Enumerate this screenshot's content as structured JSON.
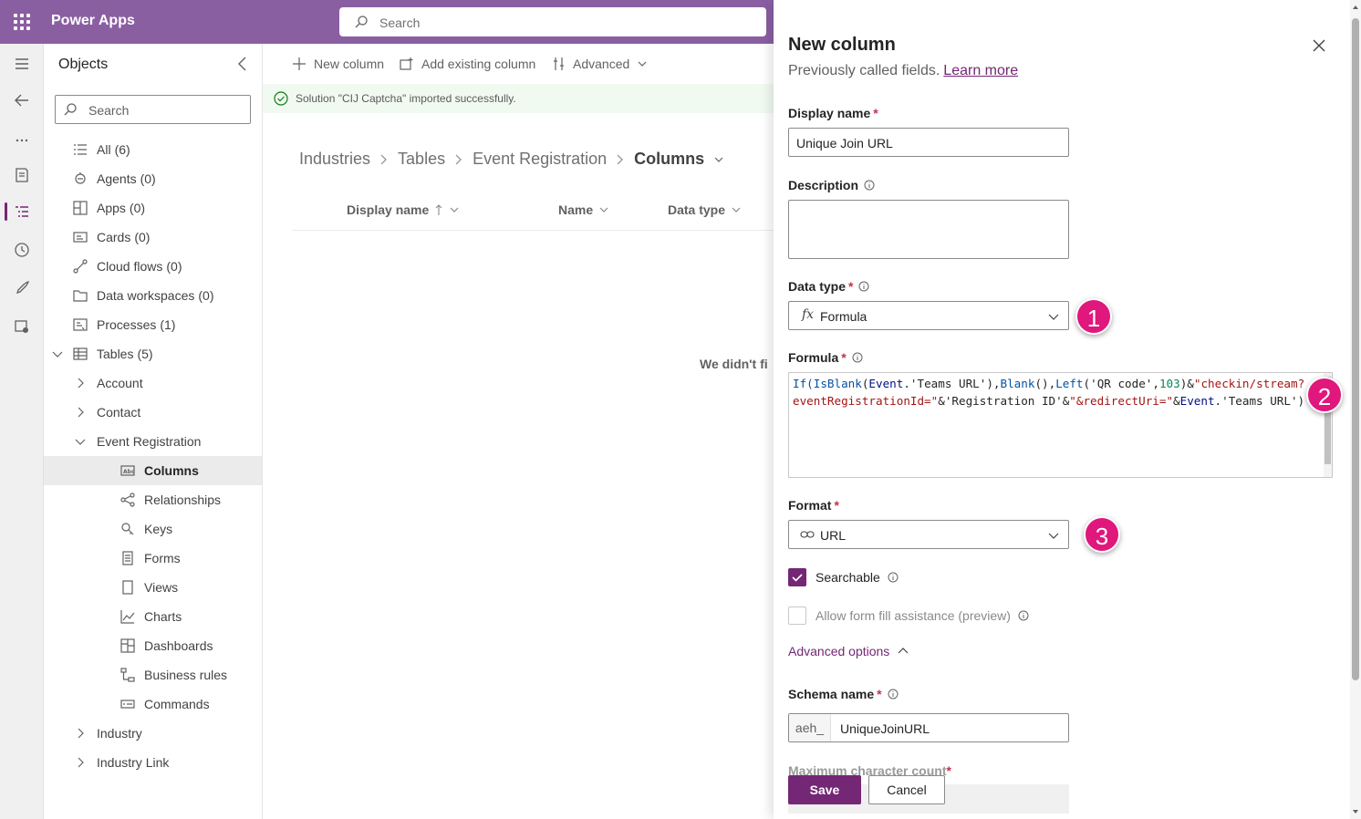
{
  "app": {
    "title": "Power Apps"
  },
  "topbar": {
    "search_placeholder": "Search"
  },
  "objects": {
    "title": "Objects",
    "search_placeholder": "Search",
    "items": [
      {
        "label": "All",
        "count": "(6)",
        "icon": "list-icon"
      },
      {
        "label": "Agents",
        "count": "(0)",
        "icon": "agent-icon"
      },
      {
        "label": "Apps",
        "count": "(0)",
        "icon": "apps-icon"
      },
      {
        "label": "Cards",
        "count": "(0)",
        "icon": "cards-icon"
      },
      {
        "label": "Cloud flows",
        "count": "(0)",
        "icon": "flow-icon"
      },
      {
        "label": "Data workspaces",
        "count": "(0)",
        "icon": "folder-icon"
      },
      {
        "label": "Processes",
        "count": "(1)",
        "icon": "process-icon"
      },
      {
        "label": "Tables",
        "count": "(5)",
        "icon": "table-icon"
      },
      {
        "label": "Account"
      },
      {
        "label": "Contact"
      },
      {
        "label": "Event Registration"
      },
      {
        "label": "Columns",
        "icon": "columns-icon"
      },
      {
        "label": "Relationships",
        "icon": "relationships-icon"
      },
      {
        "label": "Keys",
        "icon": "keys-icon"
      },
      {
        "label": "Forms",
        "icon": "forms-icon"
      },
      {
        "label": "Views",
        "icon": "views-icon"
      },
      {
        "label": "Charts",
        "icon": "charts-icon"
      },
      {
        "label": "Dashboards",
        "icon": "dashboards-icon"
      },
      {
        "label": "Business rules",
        "icon": "business-rules-icon"
      },
      {
        "label": "Commands",
        "icon": "commands-icon"
      },
      {
        "label": "Industry"
      },
      {
        "label": "Industry Link"
      }
    ]
  },
  "commandbar": {
    "new_column": "New column",
    "add_existing": "Add existing column",
    "advanced": "Advanced"
  },
  "notice": {
    "text": "Solution \"CIJ Captcha\" imported successfully."
  },
  "breadcrumb": {
    "items": [
      "Industries",
      "Tables",
      "Event Registration",
      "Columns"
    ]
  },
  "grid": {
    "headers": [
      "Display name",
      "Name",
      "Data type"
    ],
    "empty_message": "We didn't fi"
  },
  "panel": {
    "title": "New column",
    "subtitle": "Previously called fields.",
    "learn_more": "Learn more",
    "display_name_label": "Display name",
    "display_name_value": "Unique Join URL",
    "description_label": "Description",
    "data_type_label": "Data type",
    "data_type_value": "Formula",
    "formula_label": "Formula",
    "formula_line1": {
      "p1": "If(",
      "p2": "IsBlank",
      "p3": "(",
      "p4": "Event",
      "p5": ".'Teams URL'",
      "p6": "),",
      "p7": "Blank",
      "p8": "(),",
      "p9": "Left",
      "p10": "('QR code',",
      "p11": "103",
      "p12": ")&",
      "p13": "\"checkin/stream?"
    },
    "formula_line2": {
      "p1": "eventRegistrationId=\"",
      "p2": "&'Registration ID'&",
      "p3": "\"&redirectUri=\"",
      "p4": "&",
      "p5": "Event",
      "p6": ".'Teams URL')"
    },
    "format_label": "Format",
    "format_value": "URL",
    "searchable_label": "Searchable",
    "searchable_checked": true,
    "form_fill_label": "Allow form fill assistance (preview)",
    "form_fill_checked": false,
    "advanced_options": "Advanced options",
    "schema_label": "Schema name",
    "schema_prefix": "aeh_",
    "schema_value": "UniqueJoinURL",
    "max_char_label": "Maximum character count",
    "required_mark": "*",
    "save": "Save",
    "cancel": "Cancel",
    "badges": [
      "1",
      "2",
      "3"
    ]
  },
  "colors": {
    "brand": "#742774",
    "topbar": "#8a5fa2",
    "badge": "#e0177c",
    "required": "#c4314b"
  }
}
